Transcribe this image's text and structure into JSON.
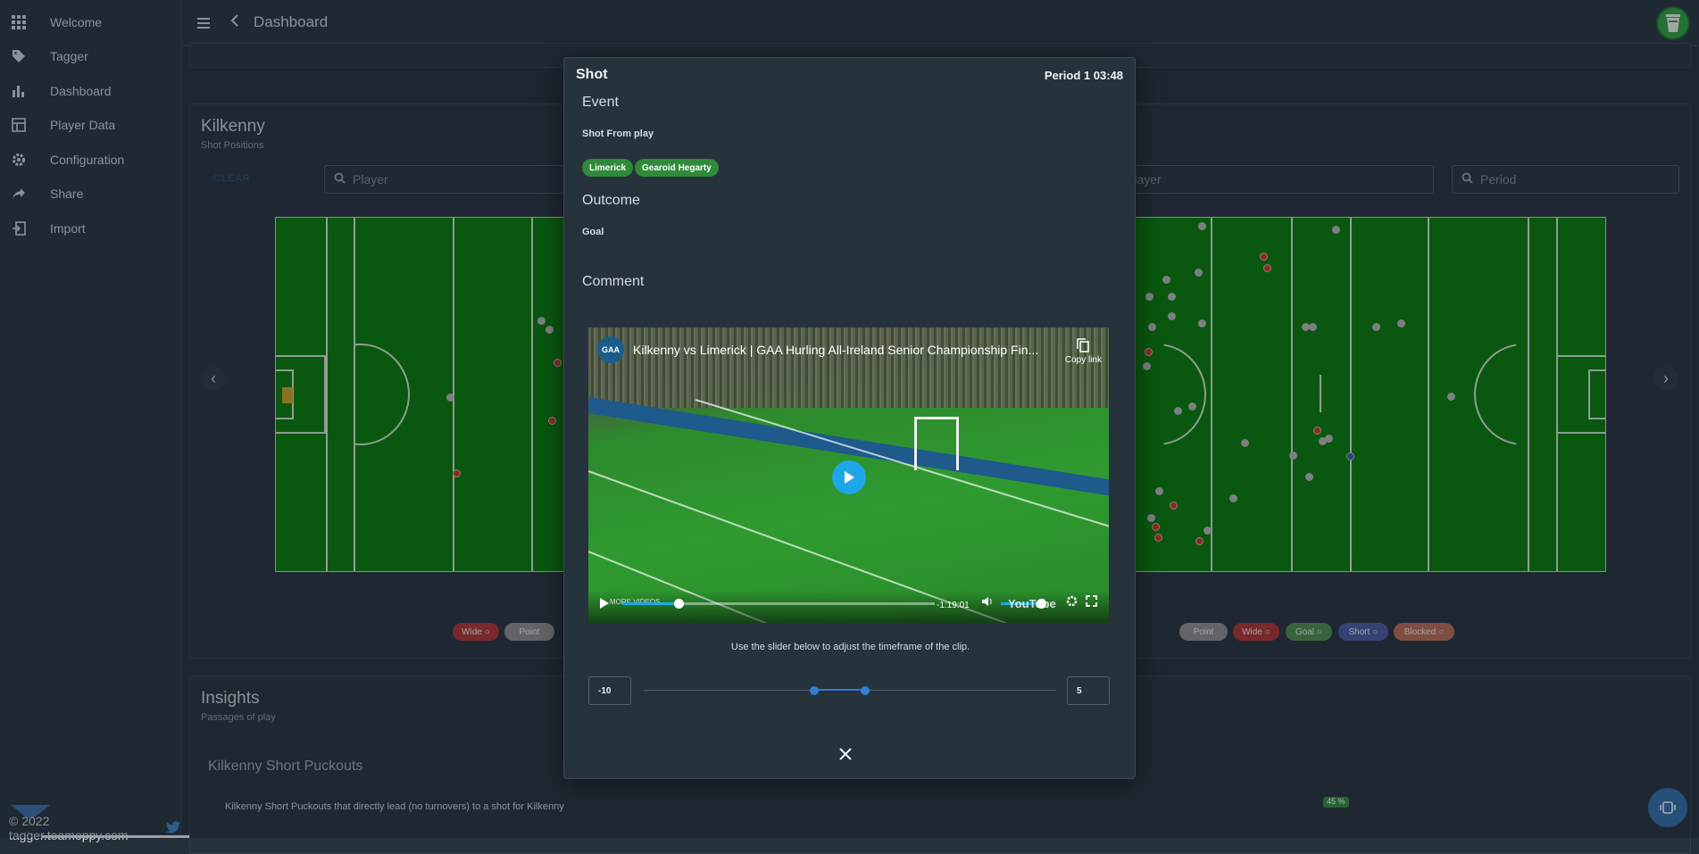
{
  "sidebar": {
    "items": [
      {
        "label": "Welcome",
        "icon": "grid-icon"
      },
      {
        "label": "Tagger",
        "icon": "tag-icon"
      },
      {
        "label": "Dashboard",
        "icon": "bar-chart-icon"
      },
      {
        "label": "Player Data",
        "icon": "table-icon"
      },
      {
        "label": "Configuration",
        "icon": "gear-icon"
      },
      {
        "label": "Share",
        "icon": "share-icon"
      },
      {
        "label": "Import",
        "icon": "import-icon"
      }
    ],
    "footer_text": "© 2022 tagger.teamoppy.com"
  },
  "topbar": {
    "title": "Dashboard"
  },
  "shot_section": {
    "title": "Kilkenny",
    "subtitle": "Shot Positions",
    "clear_label": "CLEAR",
    "player_placeholder": "Player",
    "player2_placeholder": "Player",
    "period_placeholder": "Period",
    "legend_left": [
      "Wide",
      "Point"
    ],
    "legend_right": [
      "Point",
      "Wide",
      "Goal",
      "Short",
      "Blocked"
    ]
  },
  "insights": {
    "title": "Insights",
    "subtitle": "Passages of play",
    "item_title": "Kilkenny Short Puckouts",
    "item_desc": "Kilkenny Short Puckouts that directly lead (no turnovers) to a shot for Kilkenny",
    "badge": "45 %"
  },
  "modal": {
    "title": "Shot",
    "period": "Period 1 03:48",
    "event_heading": "Event",
    "event_value": "Shot From play",
    "tags": [
      "Limerick",
      "Gearoid Hegarty"
    ],
    "outcome_heading": "Outcome",
    "outcome_value": "Goal",
    "comment_heading": "Comment",
    "video": {
      "title": "Kilkenny vs Limerick | GAA Hurling All-Ireland Senior Championship Fin...",
      "channel_logo": "GAA",
      "copy_link": "Copy link",
      "more_videos": "MORE VIDEOS",
      "time": "-1:19:01",
      "watermark": "YouTube",
      "progress": 0.18
    },
    "hint": "Use the slider below to adjust the timeframe of the clip.",
    "slider_min": "-10",
    "slider_max": "5"
  }
}
